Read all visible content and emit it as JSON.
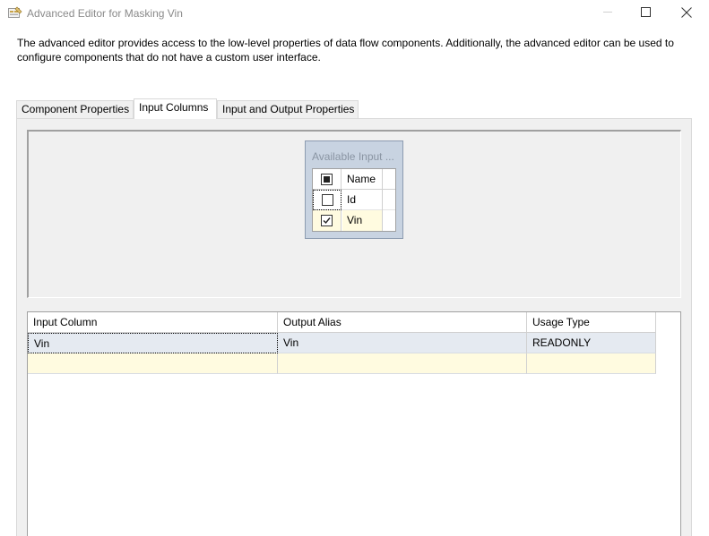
{
  "window": {
    "title": "Advanced Editor for Masking Vin",
    "icons": {
      "app": "advanced-editor-icon",
      "minimize": "minimize-icon",
      "maximize": "maximize-icon",
      "close": "close-icon"
    }
  },
  "description": {
    "line1": "The advanced editor provides access to the low-level properties of data flow components. Additionally, the advanced editor can be used to",
    "line2": "configure components that do not have a custom user interface."
  },
  "tabs": [
    {
      "label": "Component Properties",
      "selected": false
    },
    {
      "label": "Input Columns",
      "selected": true
    },
    {
      "label": "Input and Output Properties",
      "selected": false
    }
  ],
  "available_inputs": {
    "title": "Available Input ...",
    "header": {
      "name": "Name",
      "check_state": "indeterminate"
    },
    "rows": [
      {
        "name": "Id",
        "checked": false
      },
      {
        "name": "Vin",
        "checked": true
      }
    ]
  },
  "columns_grid": {
    "headers": [
      "Input Column",
      "Output Alias",
      "Usage Type"
    ],
    "rows": [
      {
        "input_column": "Vin",
        "output_alias": "Vin",
        "usage_type": "READONLY"
      }
    ]
  },
  "colors": {
    "selected_row": "#e5eaf1",
    "new_row": "#fffbe0",
    "avail_box": "#c8d3e1"
  }
}
